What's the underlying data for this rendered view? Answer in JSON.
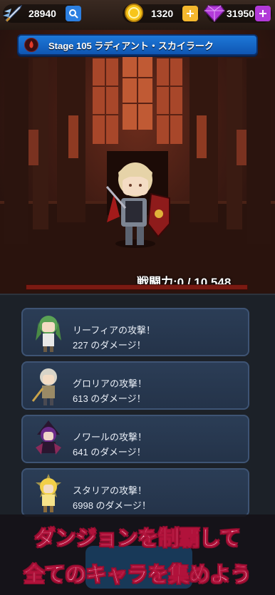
{
  "top_bar": {
    "power_value": "28940",
    "gold_value": "1320",
    "gems_value": "31950",
    "colors": {
      "gold": "#f7c51b",
      "gem": "#b23ad9",
      "add": "#f5b82e",
      "search": "#2c7fe0"
    }
  },
  "stage": {
    "title": "Stage 105 ラディアント・スカイラーク"
  },
  "scene": {
    "combat_power": "戦闘力:0 / 10,548"
  },
  "battle_log": [
    {
      "attack": "リーフィアの攻撃！",
      "damage": "227 のダメージ！",
      "portrait": "green-haired-girl-icon",
      "hair": "#5aa255",
      "outfit": "#e8e8e8"
    },
    {
      "attack": "グロリアの攻撃！",
      "damage": "613 のダメージ！",
      "portrait": "silver-knight-girl-icon",
      "hair": "#d8d4c8",
      "outfit": "#9a8a66"
    },
    {
      "attack": "ノワールの攻撃！",
      "damage": "641 のダメージ！",
      "portrait": "dark-witch-girl-icon",
      "hair": "#6b2b8a",
      "outfit": "#2a1630"
    },
    {
      "attack": "スタリアの攻撃！",
      "damage": "6998 のダメージ！",
      "portrait": "star-blonde-girl-icon",
      "hair": "#f2cf48",
      "outfit": "#f7e38a"
    }
  ],
  "promo": {
    "line1": "ダンジョンを制覇して",
    "line2": "全てのキャラを集めよう"
  }
}
